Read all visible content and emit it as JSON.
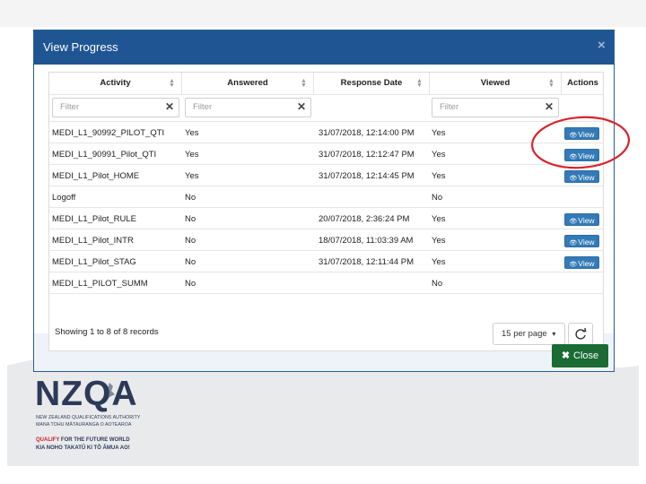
{
  "modal": {
    "title": "View Progress",
    "close_icon_glyph": "×",
    "close_button_label": "Close",
    "close_button_icon": "✖"
  },
  "table": {
    "columns": [
      {
        "label": "Activity",
        "sortable": true
      },
      {
        "label": "Answered",
        "sortable": true
      },
      {
        "label": "Response Date",
        "sortable": true
      },
      {
        "label": "Viewed",
        "sortable": true
      },
      {
        "label": "Actions",
        "sortable": false
      }
    ],
    "filter_placeholder": "Filter",
    "rows": [
      {
        "activity": "MEDI_L1_90992_PILOT_QTI",
        "answered": "Yes",
        "date": "31/07/2018, 12:14:00 PM",
        "viewed": "Yes",
        "action": "View"
      },
      {
        "activity": "MEDI_L1_90991_Pilot_QTI",
        "answered": "Yes",
        "date": "31/07/2018, 12:12:47 PM",
        "viewed": "Yes",
        "action": "View"
      },
      {
        "activity": "MEDI_L1_Pilot_HOME",
        "answered": "Yes",
        "date": "31/07/2018, 12:14:45 PM",
        "viewed": "Yes",
        "action": "View"
      },
      {
        "activity": "Logoff",
        "answered": "No",
        "date": "",
        "viewed": "No",
        "action": ""
      },
      {
        "activity": "MEDI_L1_Pilot_RULE",
        "answered": "No",
        "date": "20/07/2018, 2:36:24 PM",
        "viewed": "Yes",
        "action": "View"
      },
      {
        "activity": "MEDI_L1_Pilot_INTR",
        "answered": "No",
        "date": "18/07/2018, 11:03:39 AM",
        "viewed": "Yes",
        "action": "View"
      },
      {
        "activity": "MEDI_L1_Pilot_STAG",
        "answered": "No",
        "date": "31/07/2018, 12:11:44 PM",
        "viewed": "Yes",
        "action": "View"
      },
      {
        "activity": "MEDI_L1_PILOT_SUMM",
        "answered": "No",
        "date": "",
        "viewed": "No",
        "action": ""
      }
    ],
    "footer_info": "Showing 1 to 8 of 8 records",
    "per_page": "15 per page",
    "per_page_caret": "▾"
  },
  "logo": {
    "wordmark": "NZQA",
    "line1": "NEW ZEALAND QUALIFICATIONS AUTHORITY",
    "line2": "MANA TOHU MĀTAURANGA O AOTEAROA",
    "tagline1_accent": "QUALIFY",
    "tagline1_rest": " FOR THE FUTURE WORLD",
    "tagline2": "KIA NOHO TAKATŪ KI TŌ ĀMUA AO!"
  },
  "colors": {
    "header": "#1f5593",
    "view_button": "#337ab7",
    "close_button": "#1a6b34",
    "annotation": "#d8232a",
    "logo_navy": "#2c3a57",
    "logo_accent": "#c8202f"
  }
}
